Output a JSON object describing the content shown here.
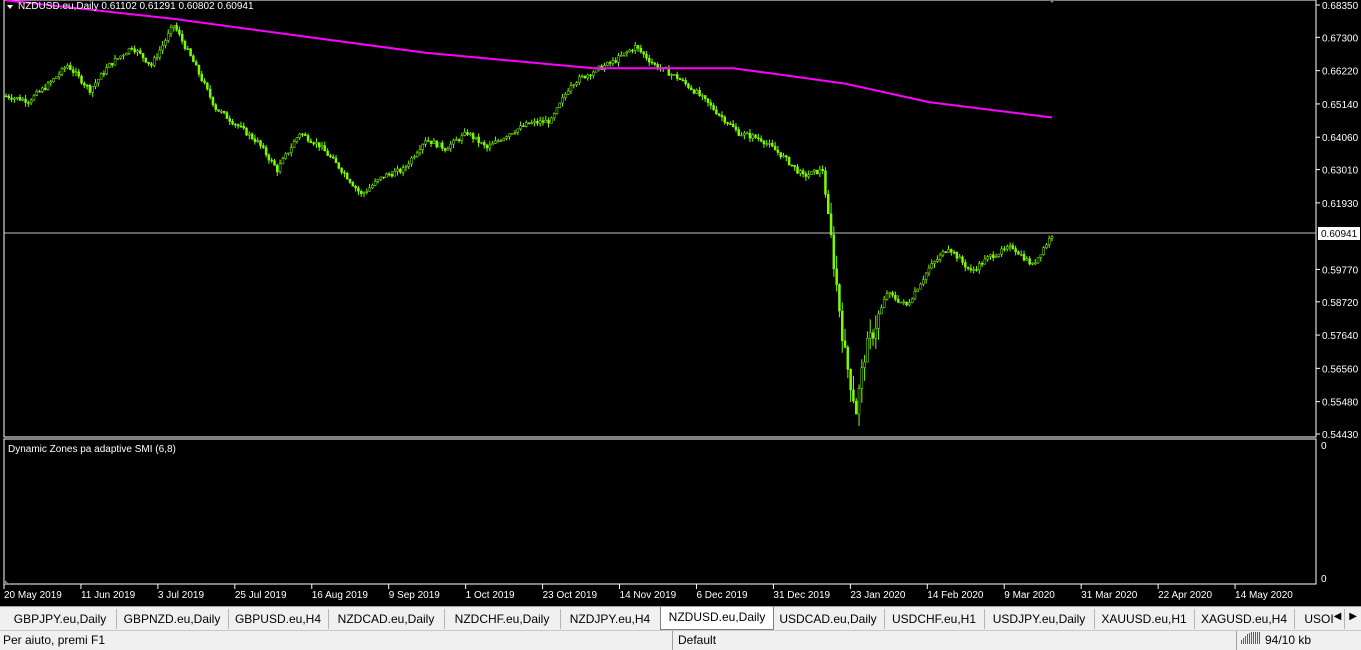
{
  "chart": {
    "header_text": "NZDUSD.eu,Daily  0.61102 0.61291 0.60802 0.60941",
    "current_price_label": "0.60941",
    "indicator_label": "Dynamic Zones pa adaptive SMI (6,8)",
    "indicator_axis_top": "0",
    "indicator_axis_bottom": "0",
    "colors": {
      "background": "#000000",
      "candles": "#7cfc00",
      "ma": "#ff00ff",
      "price_line": "#c0c0c0",
      "axis_text": "#ffffff"
    }
  },
  "chart_data": {
    "type": "candlestick",
    "symbol": "NZDUSD.eu",
    "timeframe": "Daily",
    "ohlc_last": {
      "open": 0.61102,
      "high": 0.61291,
      "low": 0.60802,
      "close": 0.60941
    },
    "y_ticks": [
      0.6835,
      0.673,
      0.6622,
      0.6514,
      0.6406,
      0.6301,
      0.6193,
      0.5977,
      0.5872,
      0.5764,
      0.5656,
      0.5548,
      0.5443
    ],
    "ylim": [
      0.5443,
      0.6835
    ],
    "x_ticks": [
      "20 May 2019",
      "11 Jun 2019",
      "3 Jul 2019",
      "25 Jul 2019",
      "16 Aug 2019",
      "9 Sep 2019",
      "1 Oct 2019",
      "23 Oct 2019",
      "14 Nov 2019",
      "6 Dec 2019",
      "31 Dec 2019",
      "23 Jan 2020",
      "14 Feb 2020",
      "9 Mar 2020",
      "31 Mar 2020",
      "22 Apr 2020",
      "14 May 2020"
    ],
    "close_path": [
      [
        0,
        0.654
      ],
      [
        8,
        0.6525
      ],
      [
        15,
        0.6575
      ],
      [
        22,
        0.664
      ],
      [
        30,
        0.656
      ],
      [
        37,
        0.664
      ],
      [
        45,
        0.67
      ],
      [
        52,
        0.664
      ],
      [
        60,
        0.677
      ],
      [
        67,
        0.665
      ],
      [
        75,
        0.65
      ],
      [
        82,
        0.645
      ],
      [
        90,
        0.639
      ],
      [
        97,
        0.63
      ],
      [
        105,
        0.642
      ],
      [
        112,
        0.638
      ],
      [
        120,
        0.63
      ],
      [
        127,
        0.622
      ],
      [
        135,
        0.628
      ],
      [
        142,
        0.63
      ],
      [
        150,
        0.64
      ],
      [
        157,
        0.637
      ],
      [
        165,
        0.642
      ],
      [
        172,
        0.637
      ],
      [
        180,
        0.642
      ],
      [
        187,
        0.645
      ],
      [
        195,
        0.646
      ],
      [
        202,
        0.658
      ],
      [
        210,
        0.662
      ],
      [
        217,
        0.665
      ],
      [
        225,
        0.67
      ],
      [
        232,
        0.664
      ],
      [
        240,
        0.66
      ],
      [
        247,
        0.655
      ],
      [
        255,
        0.648
      ],
      [
        262,
        0.642
      ],
      [
        270,
        0.64
      ],
      [
        277,
        0.635
      ],
      [
        285,
        0.628
      ],
      [
        292,
        0.63
      ],
      [
        300,
        0.57
      ],
      [
        304,
        0.552
      ],
      [
        307,
        0.57
      ],
      [
        315,
        0.59
      ],
      [
        322,
        0.586
      ],
      [
        330,
        0.598
      ],
      [
        337,
        0.605
      ],
      [
        345,
        0.597
      ],
      [
        352,
        0.602
      ],
      [
        360,
        0.605
      ],
      [
        367,
        0.599
      ],
      [
        374,
        0.609
      ]
    ],
    "close_path_note": "x = trading-day index",
    "ma_path": [
      [
        0,
        0.685
      ],
      [
        60,
        0.679
      ],
      [
        150,
        0.668
      ],
      [
        210,
        0.663
      ],
      [
        260,
        0.663
      ],
      [
        300,
        0.658
      ],
      [
        330,
        0.652
      ],
      [
        374,
        0.647
      ]
    ]
  },
  "tabs": [
    {
      "label": "GBPJPY.eu,Daily",
      "active": false
    },
    {
      "label": "GBPNZD.eu,Daily",
      "active": false
    },
    {
      "label": "GBPUSD.eu,H4",
      "active": false
    },
    {
      "label": "NZDCAD.eu,Daily",
      "active": false
    },
    {
      "label": "NZDCHF.eu,Daily",
      "active": false
    },
    {
      "label": "NZDJPY.eu,H4",
      "active": false
    },
    {
      "label": "NZDUSD.eu,Daily",
      "active": true
    },
    {
      "label": "USDCAD.eu,Daily",
      "active": false
    },
    {
      "label": "USDCHF.eu,H1",
      "active": false
    },
    {
      "label": "USDJPY.eu,Daily",
      "active": false
    },
    {
      "label": "XAUUSD.eu,H1",
      "active": false
    },
    {
      "label": "XAGUSD.eu,H4",
      "active": false
    },
    {
      "label": "USOI",
      "active": false
    }
  ],
  "tab_scroll": {
    "left_icon": "arrow-left",
    "right_icon": "arrow-right"
  },
  "status": {
    "help": "Per aiuto, premi F1",
    "profile": "Default",
    "traffic": "94/10 kb"
  }
}
